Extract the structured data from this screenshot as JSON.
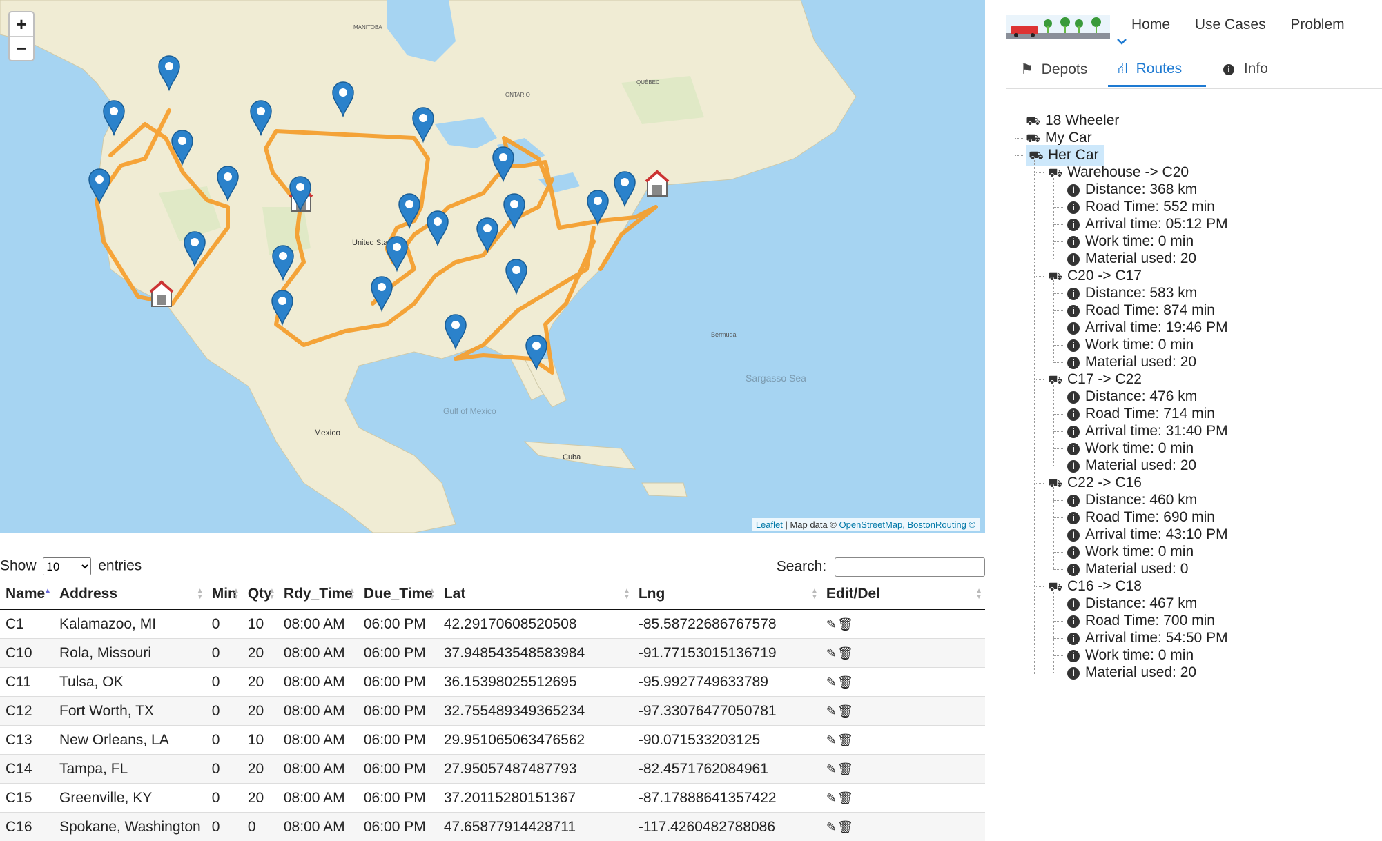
{
  "map": {
    "zoom_in": "+",
    "zoom_out": "−",
    "attribution_leaflet": "Leaflet",
    "attribution_text": "| Map data ©",
    "attribution_osm": "OpenStreetMap,",
    "attribution_br": "BostonRouting ©",
    "labels": {
      "us": "United States",
      "mexico": "Mexico",
      "cuba": "Cuba",
      "sargasso": "Sargasso Sea",
      "gulf": "Gulf of Mexico",
      "bermuda": "Bermuda",
      "ontario": "ONTARIO",
      "quebec": "QUÉBEC",
      "manitoba": "MANITOBA"
    }
  },
  "table": {
    "show_label": "Show",
    "entries_label": "entries",
    "page_size": "10",
    "search_label": "Search:",
    "columns": [
      "Name",
      "Address",
      "Min",
      "Qty",
      "Rdy_Time",
      "Due_Time",
      "Lat",
      "Lng",
      "Edit/Del"
    ],
    "rows": [
      [
        "C1",
        "Kalamazoo, MI",
        "0",
        "10",
        "08:00 AM",
        "06:00 PM",
        "42.29170608520508",
        "-85.58722686767578"
      ],
      [
        "C10",
        "Rola, Missouri",
        "0",
        "20",
        "08:00 AM",
        "06:00 PM",
        "37.948543548583984",
        "-91.77153015136719"
      ],
      [
        "C11",
        "Tulsa, OK",
        "0",
        "20",
        "08:00 AM",
        "06:00 PM",
        "36.15398025512695",
        "-95.9927749633789"
      ],
      [
        "C12",
        "Fort Worth, TX",
        "0",
        "20",
        "08:00 AM",
        "06:00 PM",
        "32.755489349365234",
        "-97.33076477050781"
      ],
      [
        "C13",
        "New Orleans, LA",
        "0",
        "10",
        "08:00 AM",
        "06:00 PM",
        "29.951065063476562",
        "-90.071533203125"
      ],
      [
        "C14",
        "Tampa, FL",
        "0",
        "20",
        "08:00 AM",
        "06:00 PM",
        "27.95057487487793",
        "-82.4571762084961"
      ],
      [
        "C15",
        "Greenville, KY",
        "0",
        "20",
        "08:00 AM",
        "06:00 PM",
        "37.20115280151367",
        "-87.17888641357422"
      ],
      [
        "C16",
        "Spokane, Washington",
        "0",
        "0",
        "08:00 AM",
        "06:00 PM",
        "47.65877914428711",
        "-117.4260482788086"
      ]
    ]
  },
  "nav": {
    "home": "Home",
    "use_cases": "Use Cases",
    "problem": "Problem"
  },
  "tabs": {
    "depots": "Depots",
    "routes": "Routes",
    "info": "Info"
  },
  "tree": {
    "vehicles": [
      "18 Wheeler",
      "My Car",
      "Her Car"
    ],
    "legs": [
      {
        "title": "Warehouse -> C20",
        "items": [
          "Distance: 368 km",
          "Road Time: 552 min",
          "Arrival time: 05:12 PM",
          "Work time: 0 min",
          "Material used: 20"
        ]
      },
      {
        "title": "C20 -> C17",
        "items": [
          "Distance: 583 km",
          "Road Time: 874 min",
          "Arrival time: 19:46 PM",
          "Work time: 0 min",
          "Material used: 20"
        ]
      },
      {
        "title": "C17 -> C22",
        "items": [
          "Distance: 476 km",
          "Road Time: 714 min",
          "Arrival time: 31:40 PM",
          "Work time: 0 min",
          "Material used: 20"
        ]
      },
      {
        "title": "C22 -> C16",
        "items": [
          "Distance: 460 km",
          "Road Time: 690 min",
          "Arrival time: 43:10 PM",
          "Work time: 0 min",
          "Material used: 0"
        ]
      },
      {
        "title": "C16 -> C18",
        "items": [
          "Distance: 467 km",
          "Road Time: 700 min",
          "Arrival time: 54:50 PM",
          "Work time: 0 min",
          "Material used: 20"
        ]
      }
    ]
  },
  "colors": {
    "accent": "#1e7ad2",
    "route": "#f5a030",
    "marker": "#2b82cb",
    "selected": "#cde8fb"
  }
}
